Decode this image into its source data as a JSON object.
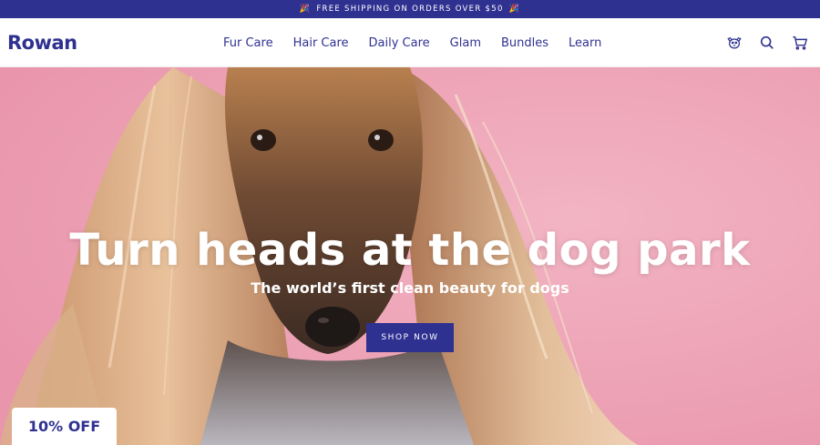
{
  "announcement": {
    "text": "Free shipping on orders over $50",
    "emoji_left": "🎉",
    "emoji_right": "🎉"
  },
  "header": {
    "logo": "Rowan",
    "nav": [
      "Fur Care",
      "Hair Care",
      "Daily Care",
      "Glam",
      "Bundles",
      "Learn"
    ],
    "icons": [
      "dog-account-icon",
      "search-icon",
      "cart-icon"
    ]
  },
  "hero": {
    "title": "Turn heads at the dog park",
    "subtitle": "The world’s first clean beauty for dogs",
    "cta": "SHOP NOW"
  },
  "discount_tab": "10% OFF",
  "colors": {
    "brand": "#2f3191",
    "hero_background": "#eea4b7"
  }
}
